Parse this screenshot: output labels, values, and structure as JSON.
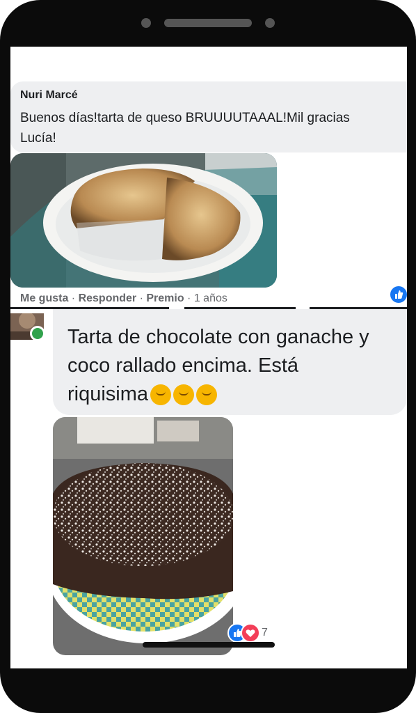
{
  "comment1": {
    "author": "Nuri Marcé",
    "text_line1": "Buenos días!tarta de queso BRUUUUTAAAL!Mil gracias",
    "text_line2": "Lucía!",
    "photo_subject": "cheesecake-photo",
    "actions": {
      "like": "Me gusta",
      "reply": "Responder",
      "award": "Premio",
      "time": "1 años",
      "separator": " · "
    },
    "reaction": "like-icon"
  },
  "comment2": {
    "text_line1": "Tarta de chocolate con ganache y",
    "text_line2": "coco rallado encima. Está",
    "text_line3": "riquisima",
    "emoji": [
      "hugging-face-emoji",
      "hugging-face-emoji",
      "hugging-face-emoji"
    ],
    "photo_subject": "chocolate-coconut-cake-photo",
    "reaction_count": "7",
    "reactions": [
      "like-icon",
      "love-icon"
    ]
  },
  "colors": {
    "bubble": "#eeeff1",
    "text": "#1c1e21",
    "meta": "#65676b",
    "facebook_blue": "#1877f2",
    "love_red": "#f33e58",
    "online_green": "#31a24c"
  }
}
